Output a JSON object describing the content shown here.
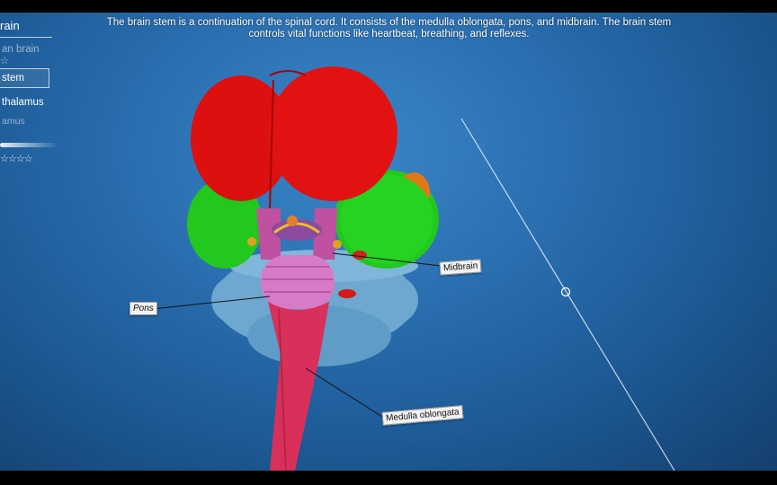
{
  "caption": "The brain stem is a continuation of the spinal cord. It consists of the medulla oblongata, pons, and midbrain. The brain stem controls vital functions like heartbeat, breathing, and reflexes.",
  "side_panel": {
    "title": "rain",
    "items": [
      {
        "label": "an brain",
        "stars": "☆"
      },
      {
        "label": " stem",
        "selected": true
      },
      {
        "label": "thalamus"
      },
      {
        "label": "amus"
      }
    ],
    "rating": "☆☆☆☆"
  },
  "labels": {
    "pons": "Pons",
    "midbrain": "Midbrain",
    "medulla": "Medulla oblongata"
  },
  "colors": {
    "cerebrum": "#e01010",
    "temporal": "#22c81e",
    "cerebellum": "#6aa6cc",
    "pons": "#d070c0",
    "medulla": "#d8305a",
    "background": "#2a6fb0"
  }
}
